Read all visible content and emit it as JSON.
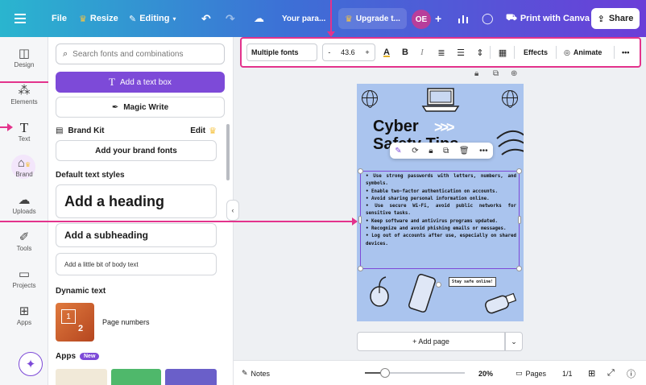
{
  "topbar": {
    "file": "File",
    "resize": "Resize",
    "editing": "Editing",
    "doc_title": "Your para...",
    "upgrade": "Upgrade t...",
    "avatar": "OE",
    "print": "Print with Canva",
    "share": "Share"
  },
  "rail": {
    "design": "Design",
    "elements": "Elements",
    "text": "Text",
    "brand": "Brand",
    "uploads": "Uploads",
    "tools": "Tools",
    "projects": "Projects",
    "apps": "Apps"
  },
  "panel": {
    "search_placeholder": "Search fonts and combinations",
    "add_textbox": "Add a text box",
    "magic_write": "Magic Write",
    "brand_kit": "Brand Kit",
    "edit": "Edit",
    "add_brand_fonts": "Add your brand fonts",
    "default_styles": "Default text styles",
    "heading": "Add a heading",
    "subheading": "Add a subheading",
    "body": "Add a little bit of body text",
    "dynamic_text": "Dynamic text",
    "page_numbers": "Page numbers",
    "pn_thumb_a": "1",
    "pn_thumb_b": "2",
    "apps": "Apps",
    "new_badge": "New"
  },
  "toolbar": {
    "font": "Multiple fonts",
    "minus": "-",
    "size": "43.6",
    "plus": "+",
    "color_letter": "A",
    "bold": "B",
    "italic": "I",
    "effects": "Effects",
    "animate": "Animate",
    "more": "•••"
  },
  "canvas": {
    "title_line1": "Cyber",
    "title_line2": "Safety Tips",
    "chevrons": ">>>",
    "tips": [
      "Use strong passwords with letters, numbers, and symbols.",
      "Enable two-factor authentication on accounts.",
      "Avoid sharing personal information online.",
      "Use secure Wi-Fi, avoid public networks for sensitive tasks.",
      "Keep software and antivirus programs updated.",
      "Recognize and avoid phishing emails or messages.",
      "Log out of accounts after use, especially on shared devices."
    ],
    "stay_safe": "Stay safe online!",
    "add_page": "+ Add page"
  },
  "bottombar": {
    "notes": "Notes",
    "zoom": "20%",
    "zoom_level": 0.2,
    "pages": "Pages",
    "page_count": "1/1"
  },
  "colors": {
    "accent": "#7d4ad8",
    "annotation": "#e3338c",
    "page_bg": "#aac4ee"
  }
}
